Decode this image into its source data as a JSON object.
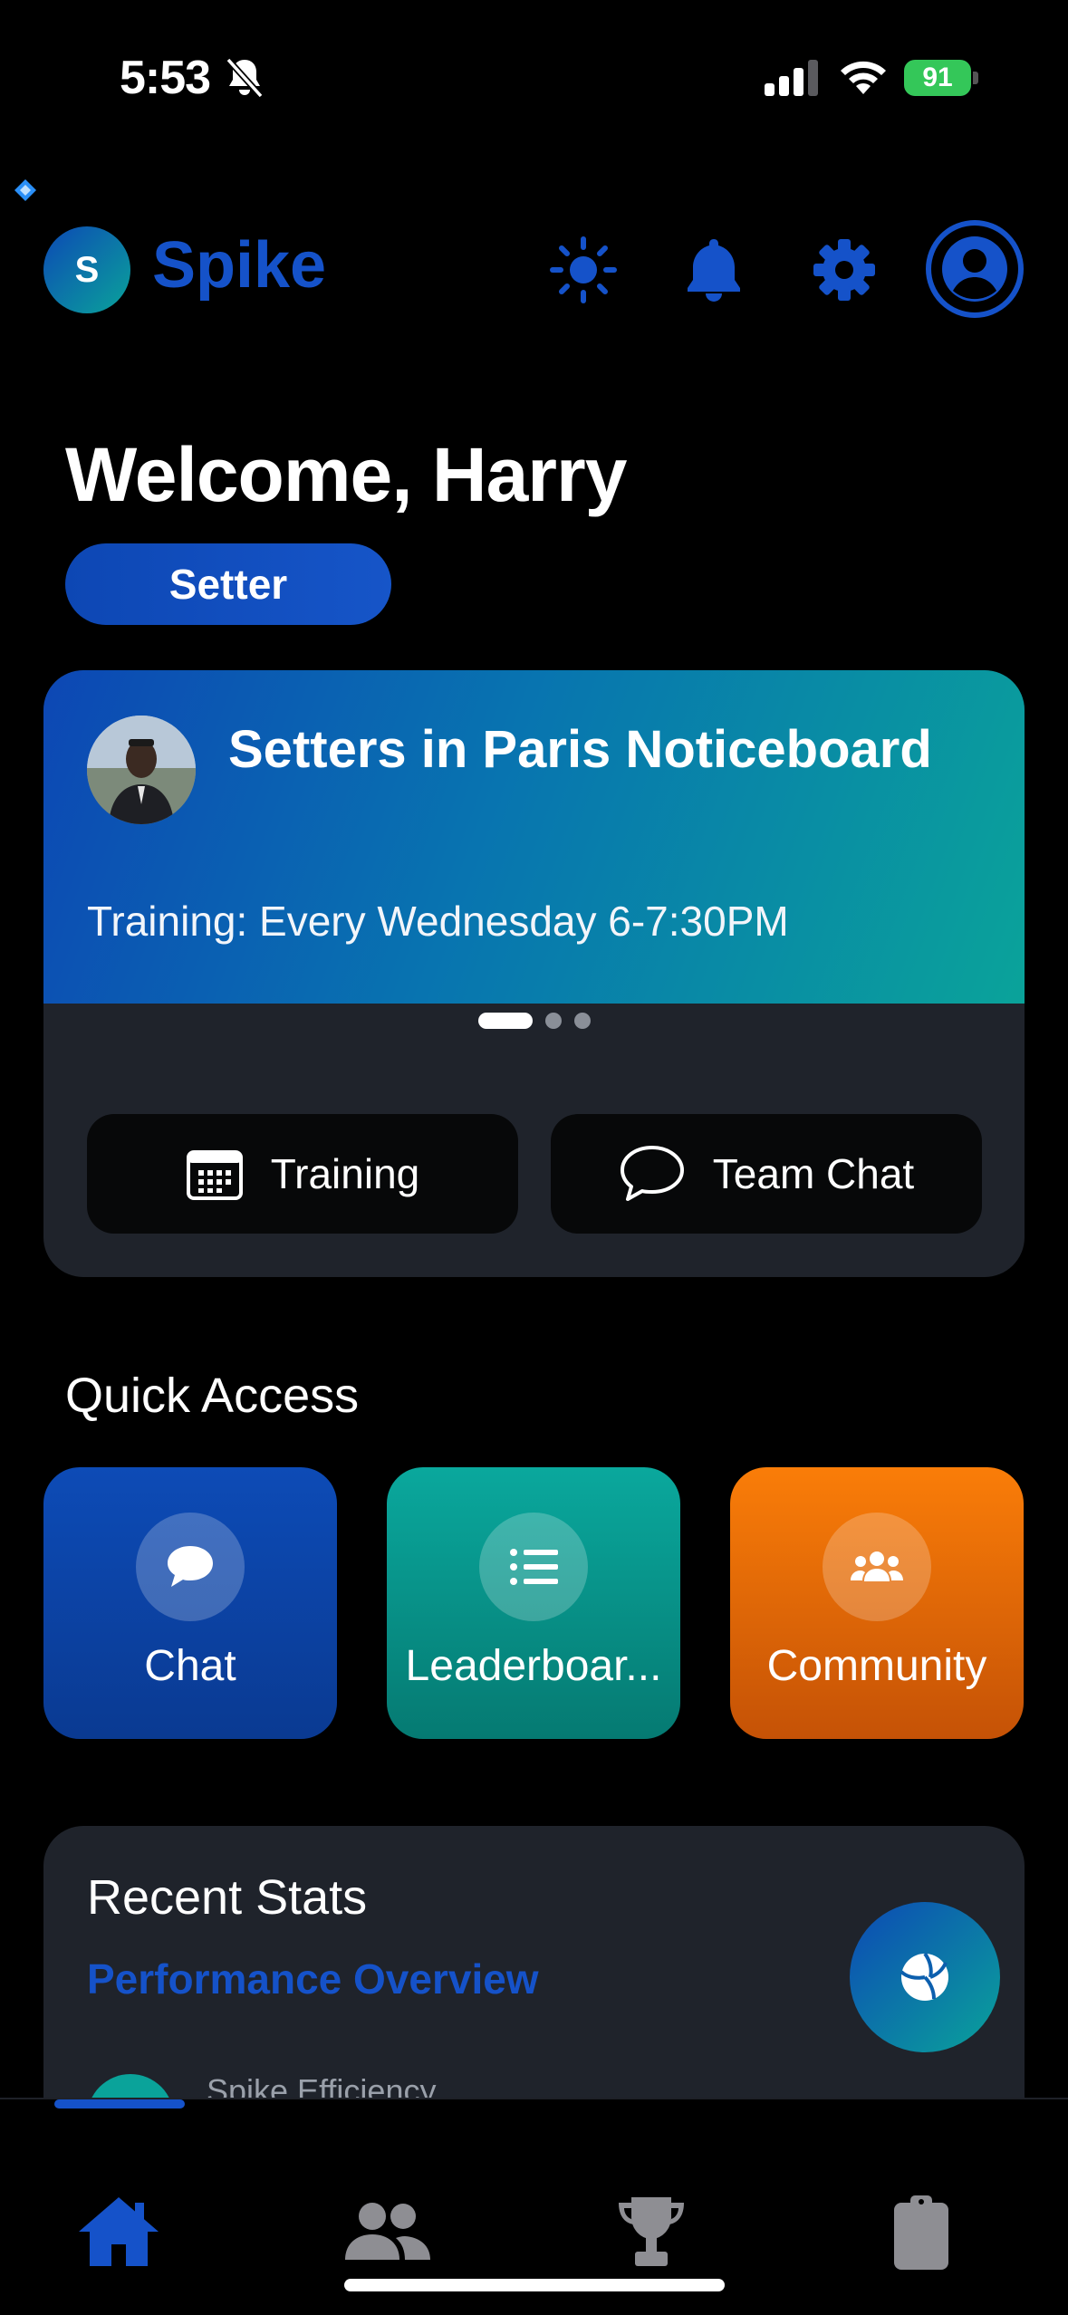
{
  "status_bar": {
    "time": "5:53",
    "battery": "91"
  },
  "header": {
    "logo_letter": "S",
    "app_name": "Spike"
  },
  "welcome": {
    "greeting": "Welcome, Harry",
    "role": "Setter"
  },
  "noticeboard": {
    "title": "Setters in Paris Noticeboard",
    "text": "Training: Every Wednesday 6-7:30PM",
    "page_count": 3,
    "active_page": 1,
    "buttons": {
      "training": "Training",
      "team_chat": "Team Chat"
    }
  },
  "quick_access": {
    "title": "Quick Access",
    "tiles": [
      {
        "label": "Chat",
        "icon": "chat-bubble-icon",
        "color": "#0d4bb6"
      },
      {
        "label": "Leaderboar...",
        "icon": "list-icon",
        "color": "#0aa89d"
      },
      {
        "label": "Community",
        "icon": "users-icon",
        "color": "#fa7d08"
      }
    ]
  },
  "recent_stats": {
    "title": "Recent Stats",
    "subtitle": "Performance Overview",
    "first_stat_label": "Spike Efficiency"
  },
  "bottom_nav": {
    "active": "home",
    "items": [
      "home-icon",
      "team-icon",
      "trophy-icon",
      "clipboard-icon"
    ]
  },
  "colors": {
    "accent": "#1552c9",
    "teal": "#0aa39a",
    "orange": "#fa7d08",
    "card": "#1f232b"
  }
}
